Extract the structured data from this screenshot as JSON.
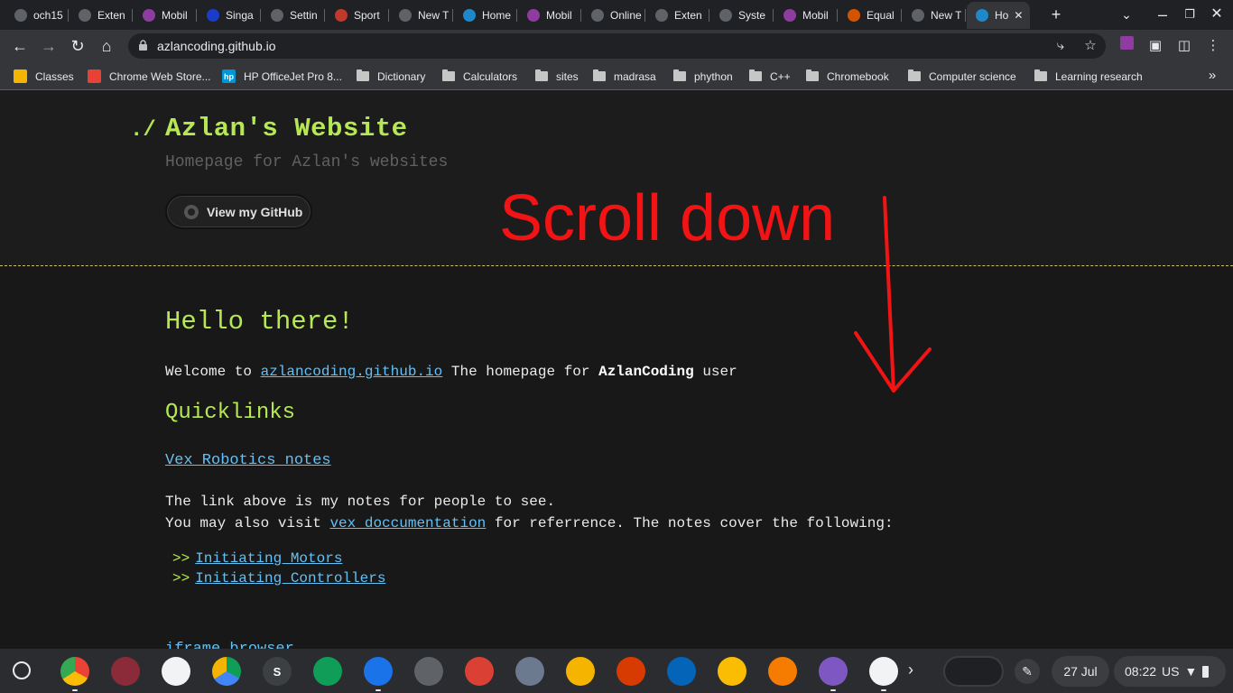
{
  "browser": {
    "tabs": [
      {
        "label": "och15",
        "icon": "chrome-icon",
        "color": "#5f6368"
      },
      {
        "label": "Exten",
        "icon": "puzzle-icon",
        "color": "#5f6368"
      },
      {
        "label": "Mobil",
        "icon": "mobile-icon",
        "color": "#8e3ca0"
      },
      {
        "label": "Singa",
        "icon": "singapore-icon",
        "color": "#1a3cc8"
      },
      {
        "label": "Settin",
        "icon": "gear-icon",
        "color": "#5f6368"
      },
      {
        "label": "Sport",
        "icon": "sports-icon",
        "color": "#c0392b"
      },
      {
        "label": "New T",
        "icon": "chrome-icon",
        "color": "#5f6368"
      },
      {
        "label": "Home",
        "icon": "page-icon",
        "color": "#1e88c9"
      },
      {
        "label": "Mobil",
        "icon": "mobile-icon",
        "color": "#8e3ca0"
      },
      {
        "label": "Online",
        "icon": "gear-icon",
        "color": "#5f6368"
      },
      {
        "label": "Exten",
        "icon": "puzzle-icon",
        "color": "#5f6368"
      },
      {
        "label": "Syste",
        "icon": "chrome-icon",
        "color": "#5f6368"
      },
      {
        "label": "Mobil",
        "icon": "mobile-icon",
        "color": "#8e3ca0"
      },
      {
        "label": "Equal",
        "icon": "doc-icon",
        "color": "#d35400"
      },
      {
        "label": "New T",
        "icon": "chrome-icon",
        "color": "#5f6368"
      },
      {
        "label": "Ho",
        "icon": "page-icon",
        "color": "#1e88c9"
      }
    ],
    "url": "azlancoding.github.io"
  },
  "bookmarks": [
    {
      "label": "Classes",
      "type": "classroom"
    },
    {
      "label": "Chrome Web Store...",
      "type": "store"
    },
    {
      "label": "HP OfficeJet Pro 8...",
      "type": "hp"
    },
    {
      "label": "Dictionary",
      "type": "folder"
    },
    {
      "label": "Calculators",
      "type": "folder"
    },
    {
      "label": "sites",
      "type": "folder"
    },
    {
      "label": "madrasa",
      "type": "folder"
    },
    {
      "label": "phython",
      "type": "folder"
    },
    {
      "label": "C++",
      "type": "folder"
    },
    {
      "label": "Chromebook",
      "type": "folder"
    },
    {
      "label": "Computer science",
      "type": "folder"
    },
    {
      "label": "Learning research",
      "type": "folder"
    }
  ],
  "page": {
    "prefix": "./",
    "title": "Azlan's Website",
    "subtitle": "Homepage for Azlan's websites",
    "github_button": "View my GitHub",
    "hello": "Hello there!",
    "welcome_pre": "Welcome to ",
    "welcome_link": "azlancoding.github.io",
    "welcome_mid": " The homepage for ",
    "welcome_bold": "AzlanCoding",
    "welcome_post": " user",
    "quicklinks_heading": "Quicklinks",
    "vex_link": "Vex Robotics notes",
    "line1": "The link above is my notes for people to see.",
    "line2_pre": "You may also visit ",
    "line2_link": "vex doccumentation",
    "line2_post": " for referrence. The notes cover the following:",
    "items": [
      {
        "marker": ">>",
        "label": "Initiating Motors"
      },
      {
        "marker": ">>",
        "label": "Initiating Controllers"
      }
    ],
    "iframe_link": "iframe browser"
  },
  "annotation": {
    "text": "Scroll down",
    "color": "#f21414"
  },
  "shelf": {
    "date": "27 Jul",
    "time": "08:22",
    "locale": "US"
  }
}
